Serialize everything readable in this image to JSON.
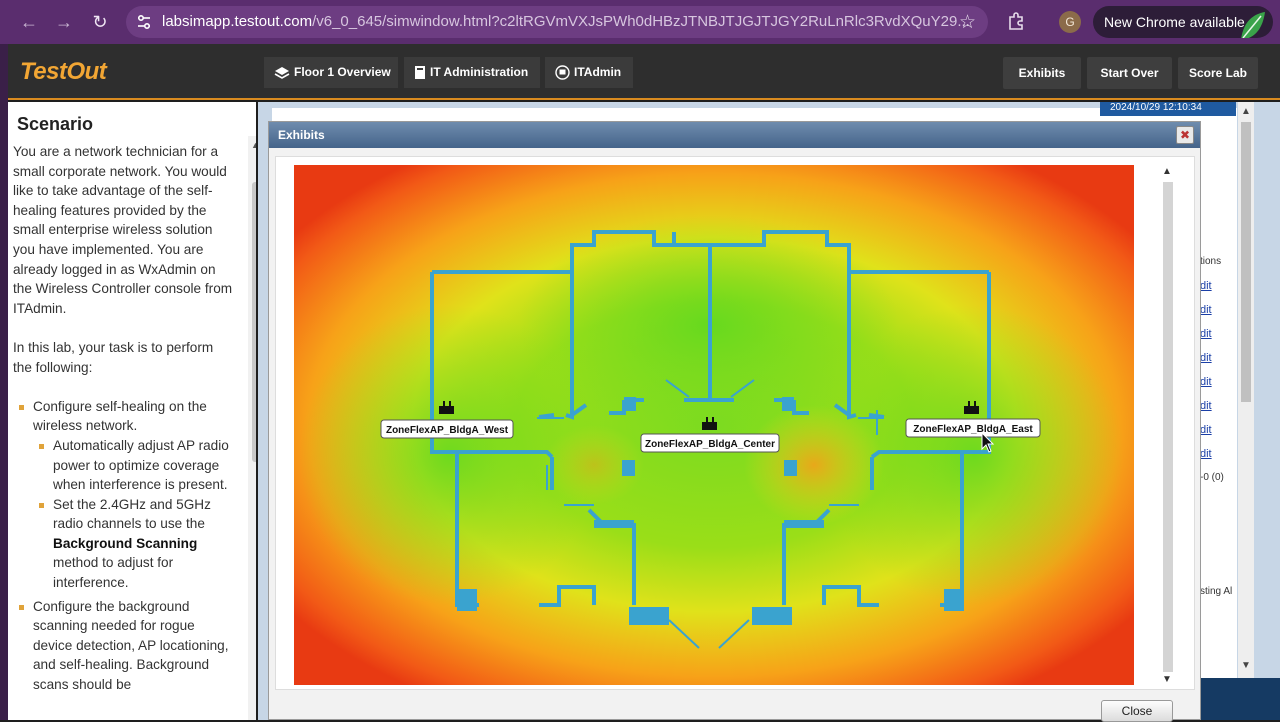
{
  "browser": {
    "url_host": "labsimapp.testout.com",
    "url_path": "/v6_0_645/simwindow.html?c2ltRGVmVXJsPWh0dHBzJTNBJTJGJTJGY2RuLnRlc3RvdXQuY29...",
    "profile_initial": "G",
    "update_label": "New Chrome available"
  },
  "header": {
    "logo": "TestOut",
    "breadcrumbs": [
      "Floor 1 Overview",
      "IT Administration",
      "ITAdmin"
    ],
    "buttons": [
      "Exhibits",
      "Start Over",
      "Score Lab"
    ]
  },
  "scenario": {
    "title": "Scenario",
    "intro": "You are a network technician for a small corporate network. You would like to take advantage of the self-healing features provided by the small enterprise wireless solution you have implemented. You are already logged in as WxAdmin on the Wireless Controller console from ITAdmin.",
    "task_intro": "In this lab, your task is to perform the following:",
    "task1": "Configure self-healing on the wireless network.",
    "task1a": "Automatically adjust AP radio power to optimize coverage when interference is present.",
    "task1b_pre": "Set the 2.4GHz and 5GHz radio channels to use the ",
    "task1b_bold": "Background Scanning",
    "task1b_post": " method to adjust for interference.",
    "task2": "Configure the background scanning needed for rogue device detection, AP locationing, and self-healing. Background scans should be"
  },
  "background_window": {
    "timestamp": "2024/10/29 12:10:34",
    "side_header": "tions",
    "side_links": [
      "dit",
      "dit",
      "dit",
      "dit",
      "dit",
      "dit",
      "dit",
      "dit"
    ],
    "side_counter": "-0 (0)",
    "side_footer": "sting Al"
  },
  "dialog": {
    "title": "Exhibits",
    "close_label": "Close",
    "access_points": [
      {
        "name": "ZoneFlexAP_BldgA_West"
      },
      {
        "name": "ZoneFlexAP_BldgA_Center"
      },
      {
        "name": "ZoneFlexAP_BldgA_East"
      }
    ]
  },
  "colors": {
    "browser_purple": "#5a2d6e",
    "header_dark": "#2e2e2e",
    "accent_orange": "#f2a634",
    "wall_blue": "#3aa3cf",
    "dialog_title": "#5a7899"
  }
}
